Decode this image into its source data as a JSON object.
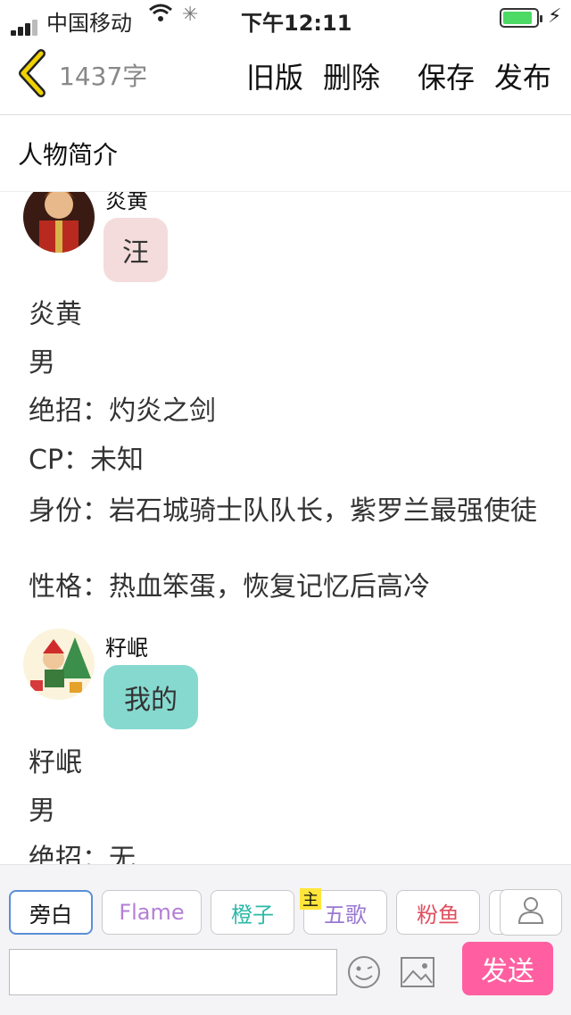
{
  "status_bar": {
    "carrier": "中国移动",
    "time": "下午12:11"
  },
  "nav": {
    "word_count": "1437字",
    "old_version": "旧版",
    "delete": "删除",
    "save": "保存",
    "publish": "发布"
  },
  "section_title": "人物简介",
  "characters": [
    {
      "name": "炎黄",
      "message": "汪",
      "bubble_color": "#f4dcdc",
      "details": [
        "炎黄",
        "男",
        "绝招：灼炎之剑",
        "CP：未知",
        "身份：岩石城骑士队队长，紫罗兰最强使徒",
        "性格：热血笨蛋，恢复记忆后高冷"
      ]
    },
    {
      "name": "籽岷",
      "message": "我的",
      "bubble_color": "#86d9cf",
      "details": [
        "籽岷",
        "男",
        "绝招：无"
      ]
    }
  ],
  "role_chips": [
    {
      "label": "旁白",
      "color": "#111111",
      "selected": true
    },
    {
      "label": "Flame",
      "color": "#b37fd6"
    },
    {
      "label": "橙子",
      "color": "#2eb9a8"
    },
    {
      "label": "五歌",
      "color": "#9a78d2",
      "badge": "主"
    },
    {
      "label": "粉鱼",
      "color": "#e04f5f"
    }
  ],
  "send_label": "发送",
  "icons": [
    "back-chevron-icon",
    "wifi-icon",
    "spinner-icon",
    "battery-icon",
    "charging-bolt-icon",
    "person-icon",
    "emoji-icon",
    "image-icon"
  ]
}
